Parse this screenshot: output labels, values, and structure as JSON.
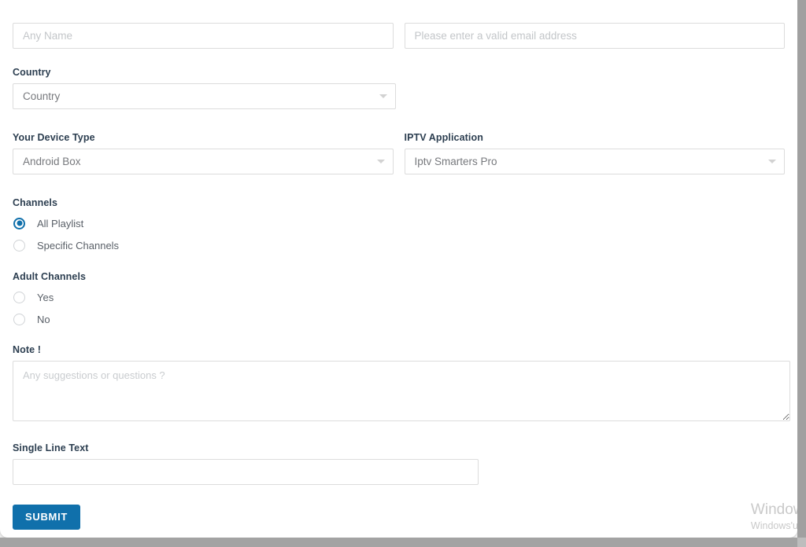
{
  "form": {
    "name_field": {
      "placeholder": "Any Name",
      "value": ""
    },
    "email_field": {
      "placeholder": "Please enter a valid email address",
      "value": ""
    },
    "country": {
      "label": "Country",
      "selected": "Country",
      "options": [
        "Country"
      ]
    },
    "device_type": {
      "label": "Your Device Type",
      "selected": "Android Box",
      "options": [
        "Android Box"
      ]
    },
    "iptv_application": {
      "label": "IPTV Application",
      "selected": "Iptv Smarters Pro",
      "options": [
        "Iptv Smarters Pro"
      ]
    },
    "channels": {
      "label": "Channels",
      "options": [
        {
          "label": "All Playlist",
          "checked": true
        },
        {
          "label": "Specific Channels",
          "checked": false
        }
      ]
    },
    "adult_channels": {
      "label": "Adult Channels",
      "options": [
        {
          "label": "Yes",
          "checked": false
        },
        {
          "label": "No",
          "checked": false
        }
      ]
    },
    "note": {
      "label": "Note !",
      "placeholder": "Any suggestions or questions ?",
      "value": ""
    },
    "single_line_text": {
      "label": "Single Line Text",
      "placeholder": "",
      "value": ""
    },
    "submit_label": "SUBMIT"
  },
  "watermark": {
    "title": "Windows",
    "subtitle": "Windows'u"
  },
  "colors": {
    "accent": "#1070ab",
    "label": "#2c3e50",
    "border": "#dcdcdc",
    "placeholder": "#c3c6c9",
    "scrollbar": "#a6a6a6"
  }
}
